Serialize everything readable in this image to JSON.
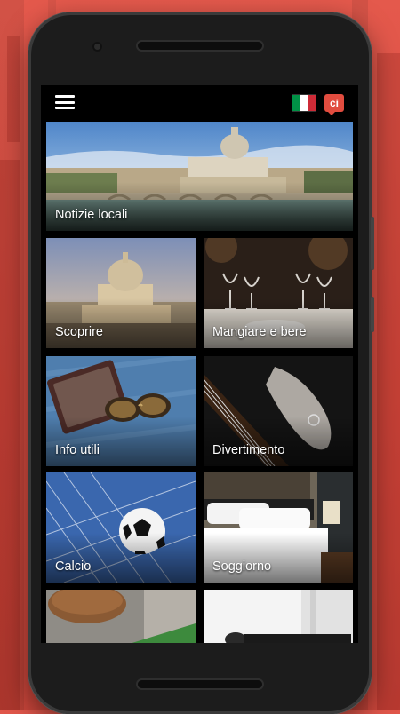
{
  "app": {
    "language_flag": "italy-flag-icon",
    "logo_text": "ci",
    "accent_color": "#e14c3f"
  },
  "tiles": [
    {
      "label": "Notizie locali",
      "icon": "rome-vatican-image"
    },
    {
      "label": "Scoprire",
      "icon": "st-peters-basilica-image"
    },
    {
      "label": "Mangiare e bere",
      "icon": "restaurant-glasses-image"
    },
    {
      "label": "Info utili",
      "icon": "passport-sunglasses-image"
    },
    {
      "label": "Divertimento",
      "icon": "guitar-image"
    },
    {
      "label": "Calcio",
      "icon": "soccer-ball-net-image"
    },
    {
      "label": "Soggiorno",
      "icon": "hotel-bed-image"
    },
    {
      "label": "",
      "icon": "cutting-board-image"
    },
    {
      "label": "",
      "icon": "microphone-image"
    }
  ]
}
